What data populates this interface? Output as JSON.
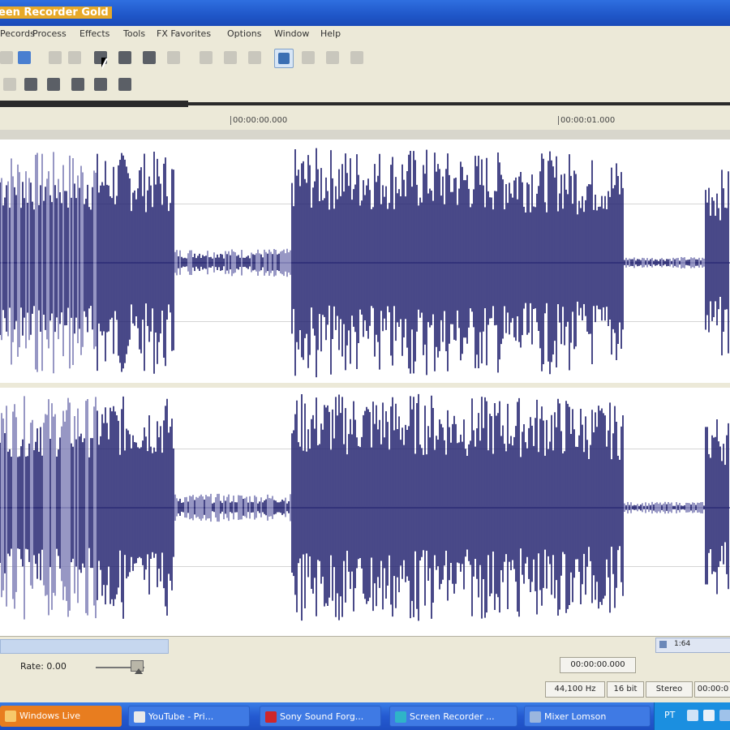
{
  "window": {
    "title": "een Recorder Gold"
  },
  "menu": [
    "Pecords",
    "Process",
    "Effects",
    "Tools",
    "FX Favorites",
    "Options",
    "Window",
    "Help"
  ],
  "ruler": {
    "marker1": "00:00:00.000",
    "marker2": "00:00:01.000"
  },
  "zoom": {
    "text": "1:64"
  },
  "transport": {
    "rate_label": "Rate: 0.00",
    "time": "00:00:00.000"
  },
  "status": [
    "44,100 Hz",
    "16 bit",
    "Stereo",
    "00:00:0"
  ],
  "taskbar": [
    {
      "label": "Windows Live",
      "color": "#e87d1f"
    },
    {
      "label": "YouTube - Pri...",
      "color": "#3f7ae4"
    },
    {
      "label": "Sony Sound Forg...",
      "color": "#3f7ae4"
    },
    {
      "label": "Screen Recorder ...",
      "color": "#3f7ae4"
    },
    {
      "label": "Mixer Lomson",
      "color": "#3f7ae4"
    }
  ],
  "tray": {
    "lang": "PT"
  },
  "colors": {
    "waveform_dark": "#1b1b6b",
    "waveform_light": "#7d7db5",
    "titlebar": "#1f56c8",
    "taskbar": "#245ad1"
  }
}
